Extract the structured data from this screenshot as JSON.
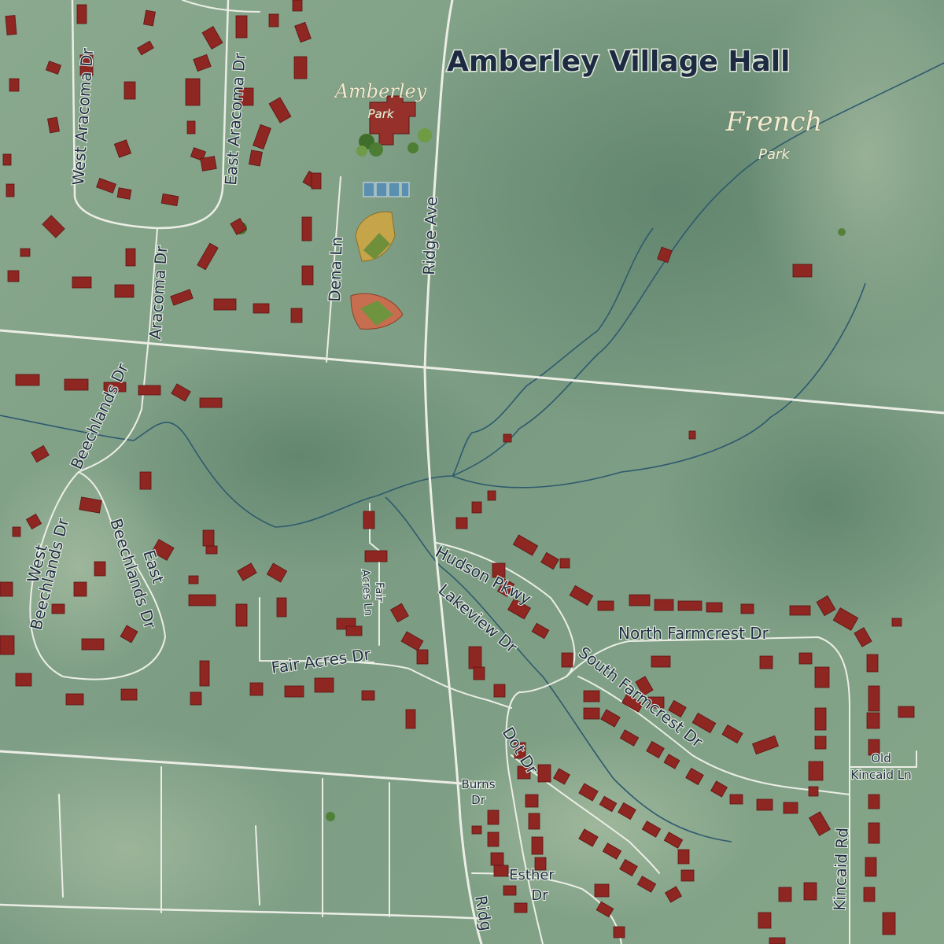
{
  "map": {
    "poi": {
      "name": "Amberley Village Hall"
    },
    "parks": [
      {
        "name": "Amberley",
        "sub": "Park"
      },
      {
        "name": "French",
        "sub": "Park"
      }
    ],
    "streets": {
      "west_aracoma": "West Aracoma Dr",
      "east_aracoma": "East Aracoma Dr",
      "aracoma": "Aracoma Dr",
      "dena": "Dena Ln",
      "ridge": "Ridge Ave",
      "ridge_partial": "Ridg",
      "beechlands": "Beechlands Dr",
      "west_beechlands_1": "West",
      "west_beechlands_2": "Beechlands Dr",
      "east_beechlands_1": "East",
      "east_beechlands_2": "Beechlands Dr",
      "fair_acres_ln_1": "Fair",
      "fair_acres_ln_2": "Acres Ln",
      "fair_acres_dr": "Fair Acres Dr",
      "hudson": "Hudson Pkwy",
      "lakeview": "Lakeview Dr",
      "north_farmcrest": "North Farmcrest Dr",
      "south_farmcrest": "South Farmcrest Dr",
      "old_kincaid_1": "Old",
      "old_kincaid_2": "Kincaid Ln",
      "kincaid": "Kincaid Rd",
      "dot": "Dot Dr",
      "burns_1": "Burns",
      "burns_2": "Dr",
      "esther_1": "Esther",
      "esther_2": "Dr"
    }
  }
}
